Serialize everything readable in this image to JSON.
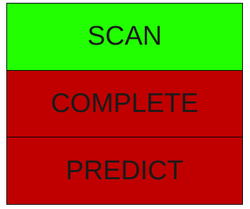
{
  "buttons": [
    {
      "label": "SCAN",
      "color": "#22ff00",
      "state": "active"
    },
    {
      "label": "COMPLETE",
      "color": "#c00000",
      "state": "inactive"
    },
    {
      "label": "PREDICT",
      "color": "#c00000",
      "state": "inactive"
    }
  ]
}
